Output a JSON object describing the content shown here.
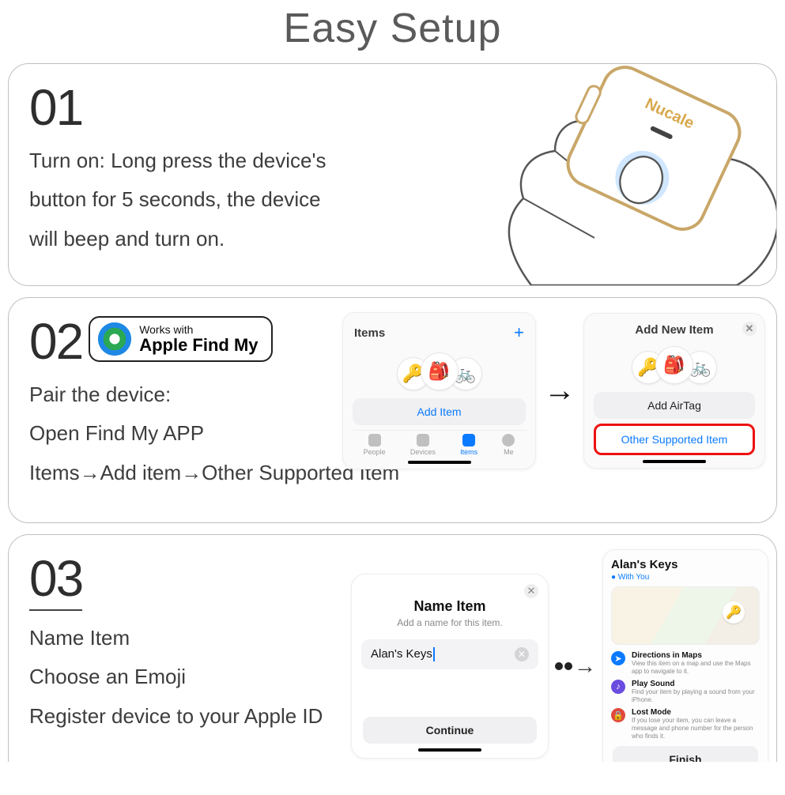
{
  "title": "Easy Setup",
  "steps": [
    {
      "num": "01",
      "lines": [
        "Turn on: Long press the device's",
        "button for 5 seconds, the device",
        "will beep and turn on."
      ],
      "device_brand": "Nucale"
    },
    {
      "num": "02",
      "badge_small": "Works with",
      "badge_big": "Apple Find My",
      "lines": [
        "Pair the device:",
        "Open Find My APP",
        "Items→Add item→Other Supported Item"
      ],
      "items_card": {
        "title": "Items",
        "add_btn": "Add Item",
        "tabs": [
          "People",
          "Devices",
          "Items",
          "Me"
        ]
      },
      "addnew_card": {
        "title": "Add New Item",
        "btn1": "Add AirTag",
        "btn2": "Other Supported Item"
      }
    },
    {
      "num": "03",
      "lines": [
        "Name Item",
        "Choose an Emoji",
        "Register device to your Apple ID"
      ],
      "name_card": {
        "title": "Name Item",
        "sub": "Add a name for this item.",
        "value": "Alan's Keys",
        "continue": "Continue"
      },
      "detail_card": {
        "title": "Alan's Keys",
        "sub": "● With You",
        "opts": [
          {
            "t": "Directions in Maps",
            "s": "View this item on a map and use the Maps app to navigate to it."
          },
          {
            "t": "Play Sound",
            "s": "Find your item by playing a sound from your iPhone."
          },
          {
            "t": "Lost Mode",
            "s": "If you lose your item, you can leave a message and phone number for the person who finds it."
          }
        ],
        "finish": "Finish"
      }
    }
  ]
}
